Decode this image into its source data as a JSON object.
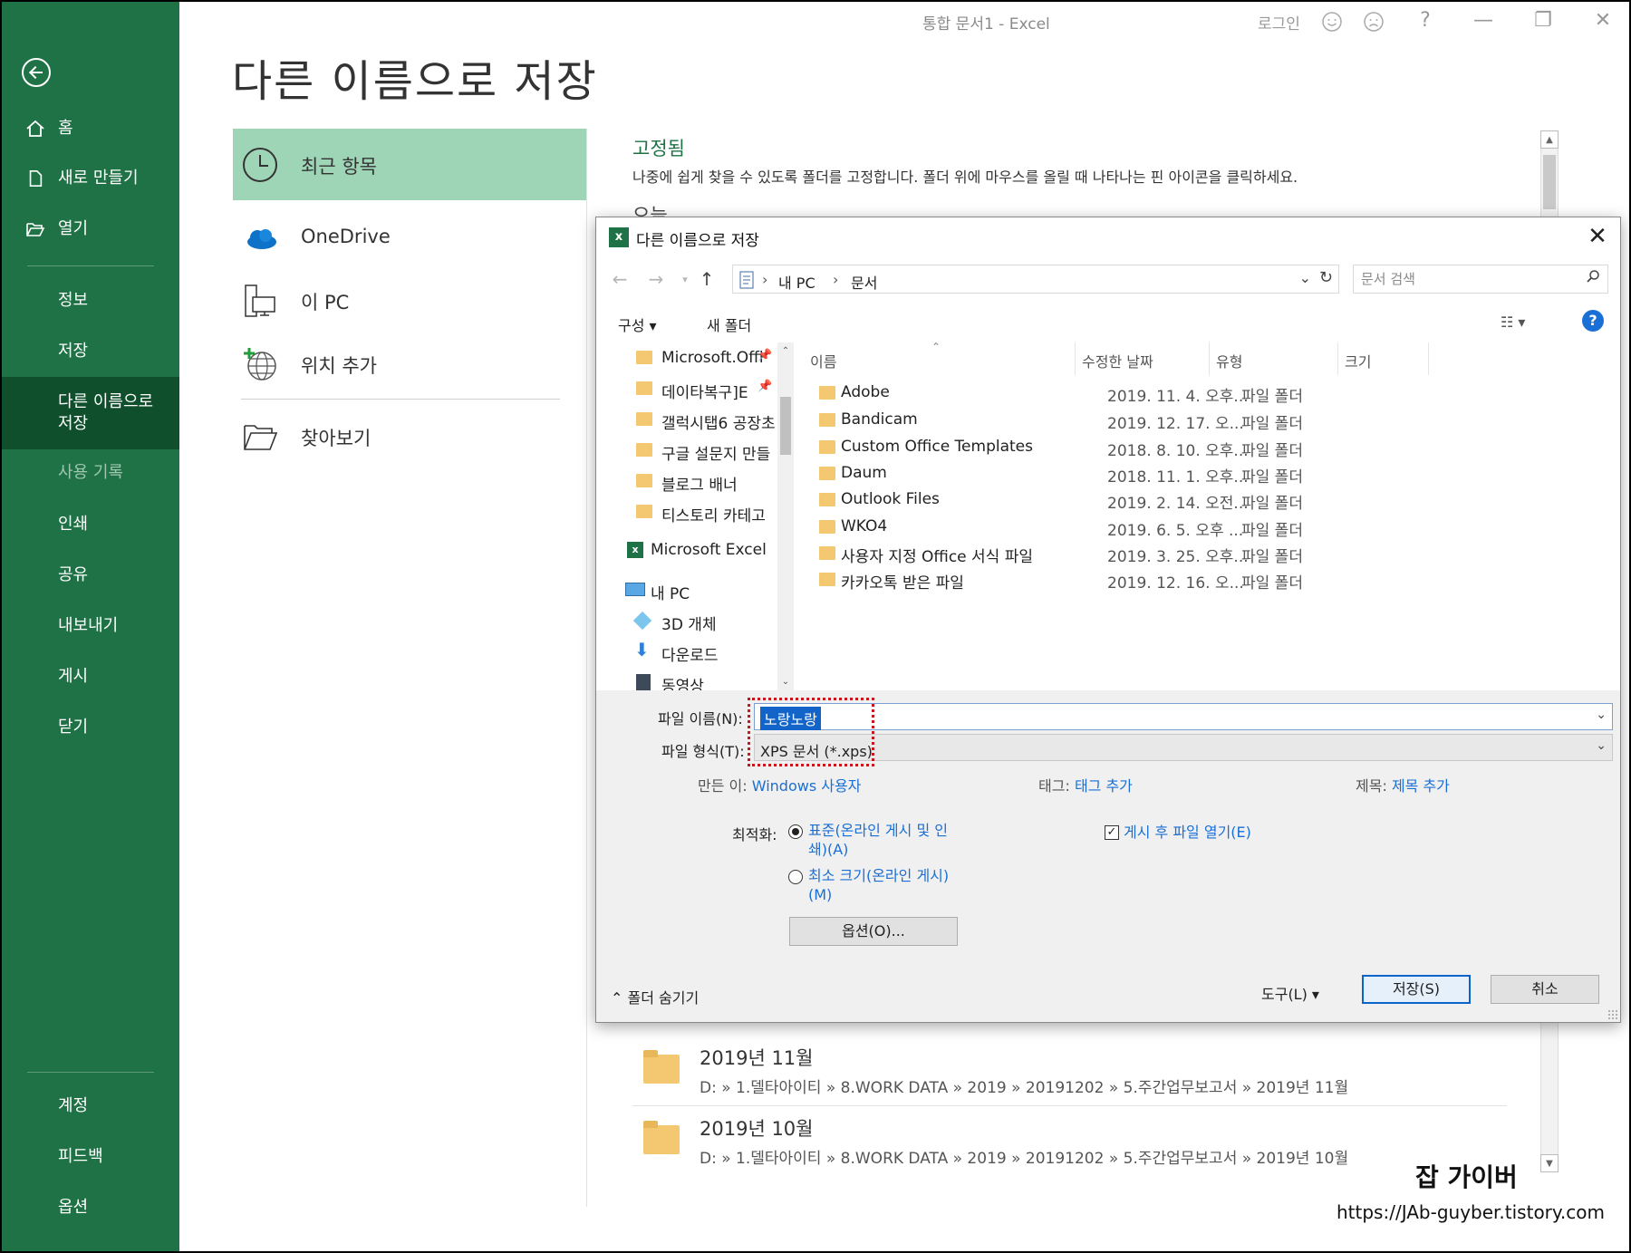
{
  "window": {
    "title": "통합 문서1  -  Excel",
    "signin": "로그인",
    "help_glyph": "?",
    "minimize_glyph": "—",
    "restore_glyph": "❐",
    "close_glyph": "✕"
  },
  "nav": {
    "home": "홈",
    "new": "새로 만들기",
    "open": "열기",
    "info": "정보",
    "save": "저장",
    "save_as": "다른 이름으로\n저장",
    "history": "사용 기록",
    "print": "인쇄",
    "share": "공유",
    "export": "내보내기",
    "publish": "게시",
    "close": "닫기",
    "account": "계정",
    "feedback": "피드백",
    "options": "옵션"
  },
  "page_title": "다른 이름으로 저장",
  "locations": {
    "recent": "최근 항목",
    "onedrive": "OneDrive",
    "this_pc": "이 PC",
    "add_place": "위치 추가",
    "browse": "찾아보기"
  },
  "right_pane": {
    "pinned_title": "고정됨",
    "pinned_desc": "나중에 쉽게 찾을 수 있도록 폴더를 고정합니다. 폴더 위에 마우스를 올릴 때 나타나는 핀 아이콘을 클릭하세요.",
    "today_title": "오늘",
    "recent": [
      {
        "name": "2019년 11월",
        "path": "D: » 1.델타아이티 » 8.WORK DATA » 2019 » 20191202 » 5.주간업무보고서 » 2019년 11월"
      },
      {
        "name": "2019년 10월",
        "path": "D: » 1.델타아이티 » 8.WORK DATA » 2019 » 20191202 » 5.주간업무보고서 » 2019년 10월"
      }
    ]
  },
  "watermark": {
    "name": "잡 가이버",
    "url": "https://JAb-guyber.tistory.com"
  },
  "dialog": {
    "title": "다른 이름으로 저장",
    "address": {
      "pc": "내 PC",
      "folder": "문서"
    },
    "search_placeholder": "문서 검색",
    "organize": "구성 ▾",
    "new_folder": "새 폴더",
    "view_glyph": "☷ ▾",
    "tree": [
      {
        "label": "Microsoft.Offi",
        "pinned": true,
        "kind": "folder"
      },
      {
        "label": "데이타복구]E",
        "pinned": true,
        "kind": "folder"
      },
      {
        "label": "갤럭시탭6 공장초",
        "pinned": false,
        "kind": "folder"
      },
      {
        "label": "구글 설문지 만들",
        "pinned": false,
        "kind": "folder"
      },
      {
        "label": "블로그 배너",
        "pinned": false,
        "kind": "folder"
      },
      {
        "label": "티스토리 카테고",
        "pinned": false,
        "kind": "folder"
      },
      {
        "label": "Microsoft Excel",
        "pinned": false,
        "kind": "excel"
      },
      {
        "label": "내 PC",
        "pinned": false,
        "kind": "pc"
      },
      {
        "label": "3D 개체",
        "pinned": false,
        "kind": "3d"
      },
      {
        "label": "다운로드",
        "pinned": false,
        "kind": "download"
      },
      {
        "label": "동영상",
        "pinned": false,
        "kind": "video"
      }
    ],
    "columns": {
      "name": "이름",
      "modified": "수정한 날짜",
      "type": "유형",
      "size": "크기"
    },
    "files": [
      {
        "name": "Adobe",
        "date": "2019. 11. 4. 오후...",
        "type": "파일 폴더"
      },
      {
        "name": "Bandicam",
        "date": "2019. 12. 17. 오...",
        "type": "파일 폴더"
      },
      {
        "name": "Custom Office Templates",
        "date": "2018. 8. 10. 오후...",
        "type": "파일 폴더"
      },
      {
        "name": "Daum",
        "date": "2018. 11. 1. 오후...",
        "type": "파일 폴더"
      },
      {
        "name": "Outlook Files",
        "date": "2019. 2. 14. 오전...",
        "type": "파일 폴더"
      },
      {
        "name": "WKO4",
        "date": "2019. 6. 5. 오후 ...",
        "type": "파일 폴더"
      },
      {
        "name": "사용자 지정 Office 서식 파일",
        "date": "2019. 3. 25. 오후...",
        "type": "파일 폴더"
      },
      {
        "name": "카카오톡 받은 파일",
        "date": "2019. 12. 16. 오...",
        "type": "파일 폴더"
      }
    ],
    "filename_label": "파일 이름(N):",
    "filename_value": "노랑노랑",
    "filetype_label": "파일 형식(T):",
    "filetype_value": "XPS 문서 (*.xps)",
    "authors_label": "만든 이:",
    "authors_value": "Windows 사용자",
    "tags_label": "태그:",
    "tags_value": "태그 추가",
    "title_label": "제목:",
    "title_value": "제목 추가",
    "optimize_label": "최적화:",
    "opt_standard": "표준(온라인 게시 및 인쇄)(A)",
    "opt_minimum": "최소 크기(온라인 게시)(M)",
    "open_after": "게시 후 파일 열기(E)",
    "options_button": "옵션(O)...",
    "hide_folders": "폴더 숨기기",
    "tools": "도구(L)   ▾",
    "save_button": "저장(S)",
    "cancel_button": "취소"
  },
  "colors": {
    "nav_green": "#1f7246",
    "nav_selected": "#0f4f2c",
    "recent_highlight": "#9fd5b7",
    "link_blue": "#1a6fd6",
    "annotation_red": "#c8161e"
  }
}
